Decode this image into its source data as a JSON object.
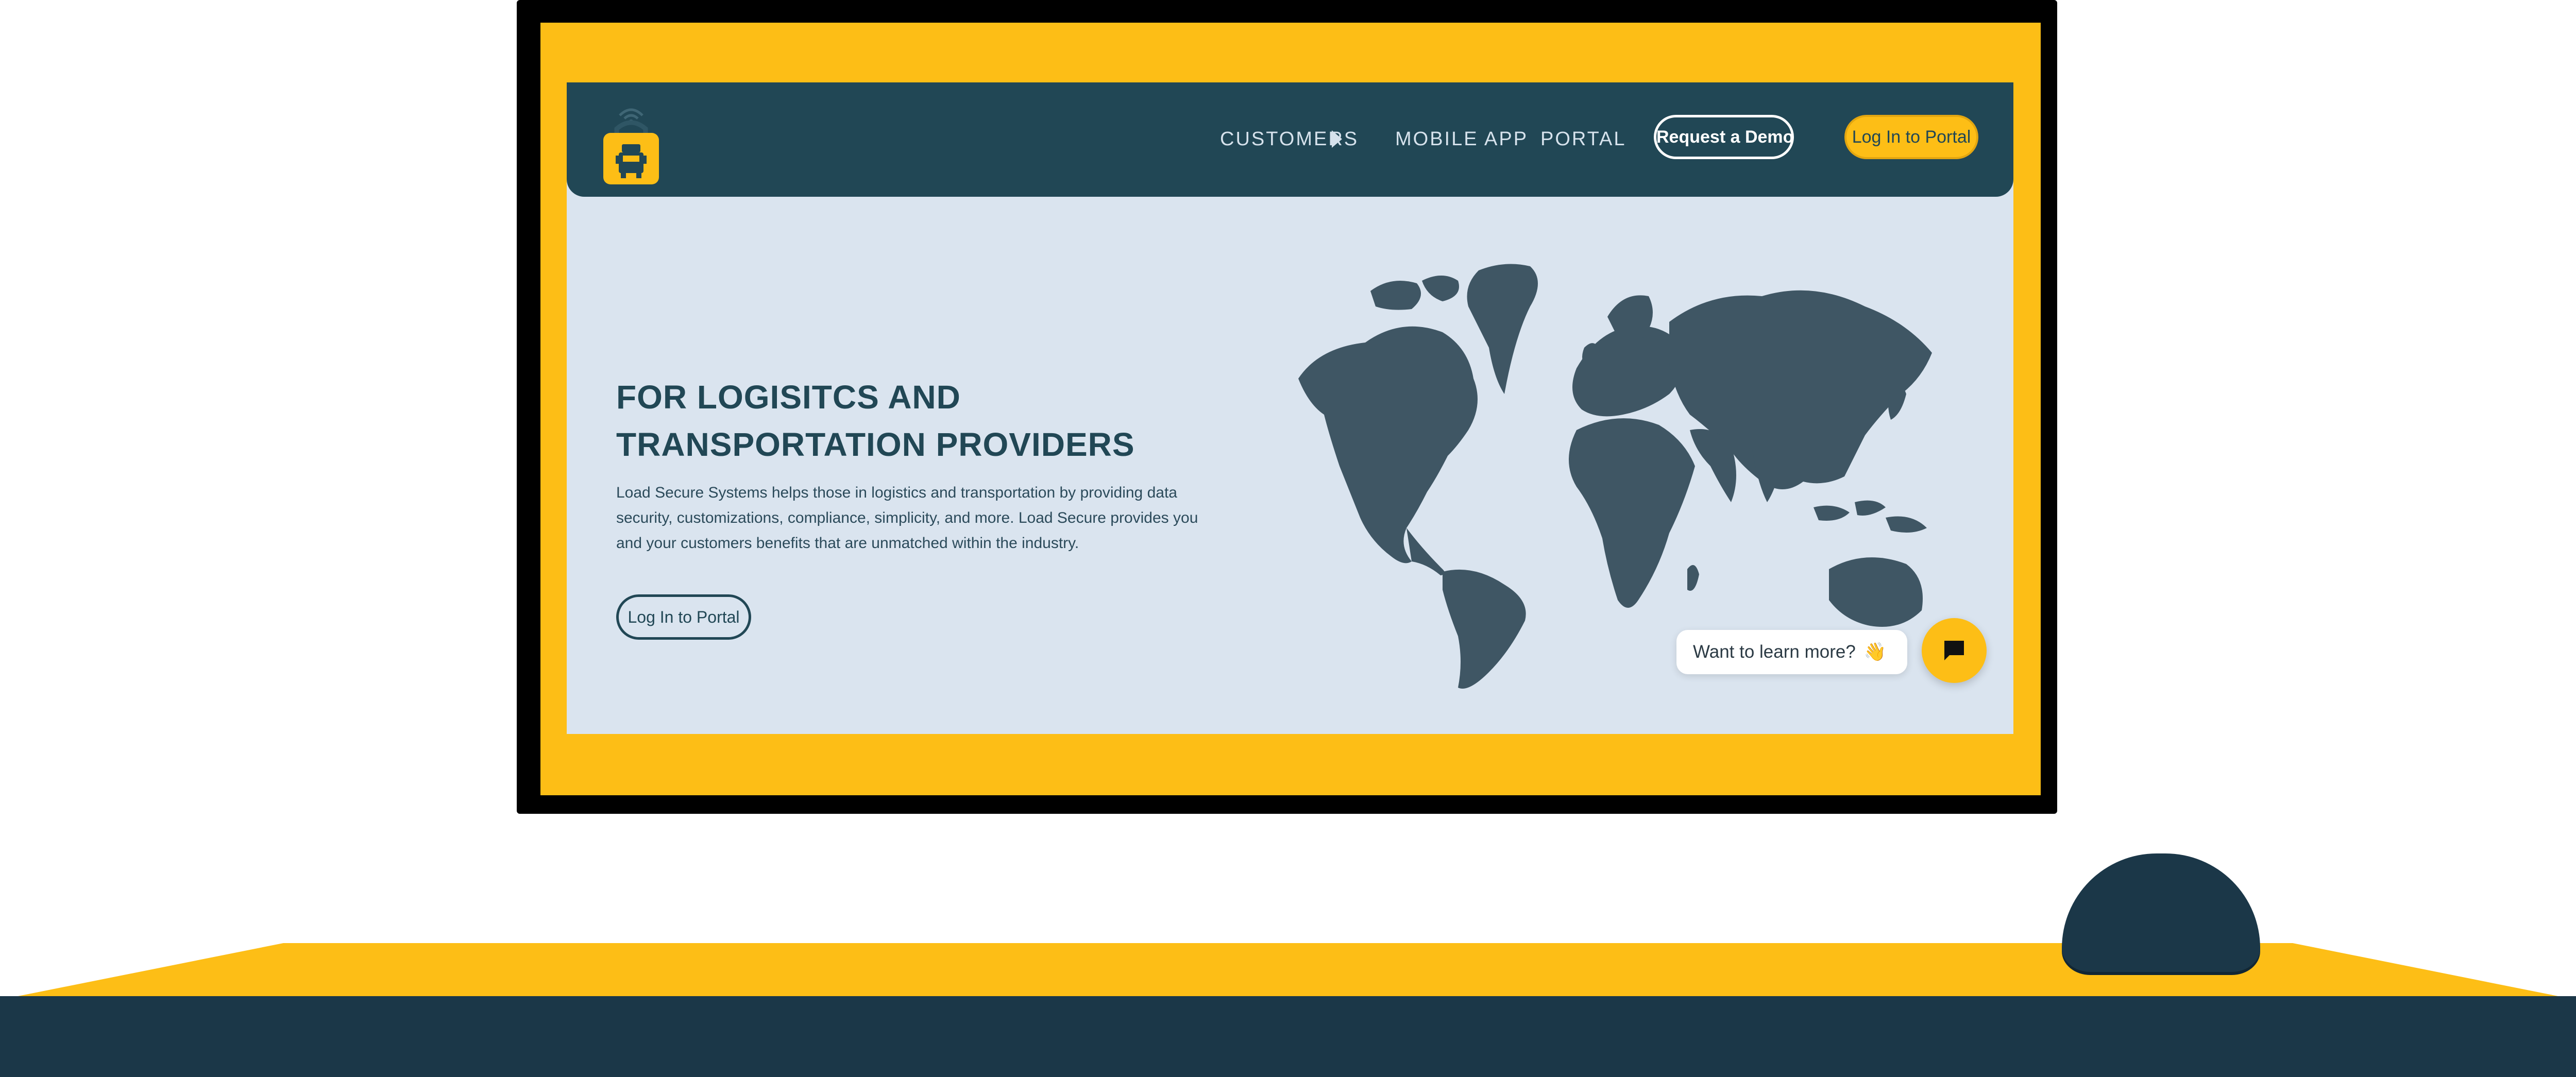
{
  "nav": {
    "items": [
      {
        "label": "CUSTOMERS"
      },
      {
        "label": "MOBILE APP"
      },
      {
        "label": "PORTAL"
      }
    ],
    "demo_label": "Request a Demo",
    "login_label": "Log In to Portal"
  },
  "hero": {
    "title_line1": "FOR LOGISITCS AND",
    "title_line2": "TRANSPORTATION PROVIDERS",
    "body": "Load Secure Systems helps those in logistics and transportation by providing data security, customizations, compliance, simplicity, and more. Load Secure provides you and your customers benefits that are unmatched within the industry.",
    "cta_label": "Log In to Portal"
  },
  "chat": {
    "prompt": "Want to learn more?",
    "wave_emoji": "👋"
  },
  "colors": {
    "brand_yellow": "#FDBE16",
    "nav_navy": "#214755",
    "hero_bg": "#DAE4EF",
    "map_fill": "#3F5664",
    "floor_navy": "#1B3748"
  },
  "icons": [
    "lock-truck-logo-icon",
    "chevron-right-icon",
    "chat-icon",
    "wave-icon"
  ]
}
